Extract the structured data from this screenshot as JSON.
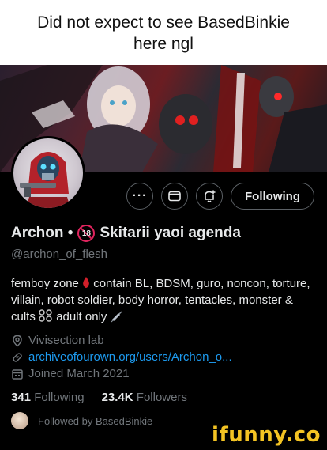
{
  "caption": {
    "text": "Did not expect to see BasedBinkie\nhere ngl"
  },
  "profile": {
    "display_name": "Archon •",
    "name_suffix": "Skitarii yaoi agenda",
    "age_badge": "18",
    "handle": "@archon_of_flesh",
    "bio_parts": [
      "femboy zone ",
      "contain BL, BDSM, guro, noncon, torture, villain, robot soldier, body horror, tentacles, monster & cults",
      " adult only "
    ],
    "location": "Vivisection lab",
    "website": "archiveofourown.org/users/Archon_o...",
    "joined": "Joined March 2021"
  },
  "actions": {
    "more_icon": "more-icon",
    "message_icon": "message-icon",
    "notify_icon": "bell-plus-icon",
    "following_label": "Following"
  },
  "stats": {
    "following_count": "341",
    "following_label": "Following",
    "followers_count": "23.4K",
    "followers_label": "Followers"
  },
  "followed_by": "Followed by BasedBinkie",
  "watermark": "ifunny.co",
  "colors": {
    "accent": "#1d9bf0",
    "muted": "#71767b",
    "text": "#e7e9ea",
    "watermark": "#f3c323",
    "badge": "#e0245e"
  }
}
